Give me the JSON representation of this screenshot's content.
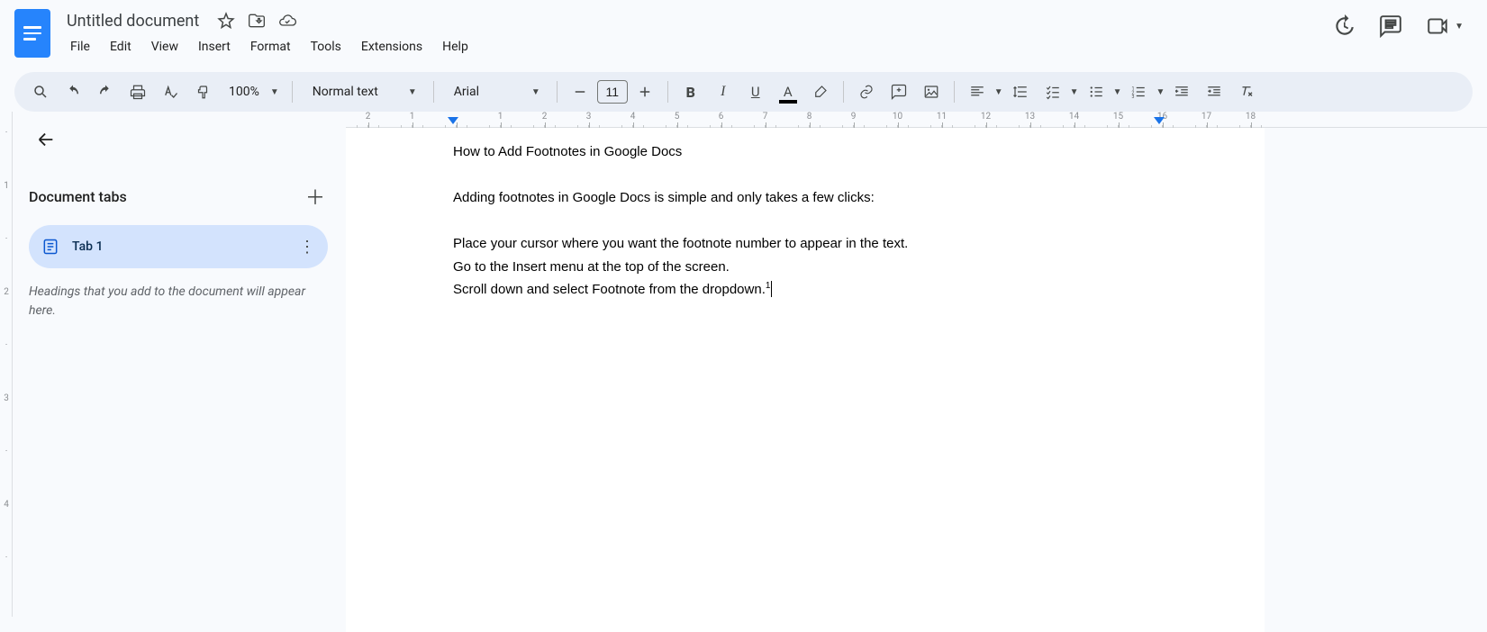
{
  "header": {
    "title": "Untitled document",
    "menus": [
      "File",
      "Edit",
      "View",
      "Insert",
      "Format",
      "Tools",
      "Extensions",
      "Help"
    ]
  },
  "toolbar": {
    "zoom": "100%",
    "style": "Normal text",
    "font": "Arial",
    "font_size": "11"
  },
  "sidebar": {
    "title": "Document tabs",
    "tab1": "Tab 1",
    "hint": "Headings that you add to the document will appear here."
  },
  "ruler": {
    "h": [
      "2",
      "1",
      "",
      "1",
      "2",
      "3",
      "4",
      "5",
      "6",
      "7",
      "8",
      "9",
      "10",
      "11",
      "12",
      "13",
      "14",
      "15",
      "16",
      "17",
      "18"
    ]
  },
  "doc": {
    "p1": "How to Add Footnotes in Google Docs",
    "p2": "Adding footnotes in Google Docs is simple and only takes a few clicks:",
    "p3": "Place your cursor where you want the footnote number to appear in the text.",
    "p4": "Go to the Insert menu at the top of the screen.",
    "p5": "Scroll down and select Footnote from the dropdown.",
    "p5_foot": "1"
  }
}
